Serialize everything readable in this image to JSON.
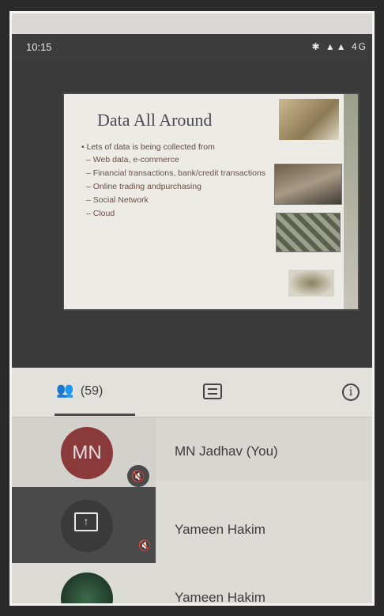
{
  "status_bar": {
    "time": "10:15",
    "network": "4G"
  },
  "slide": {
    "title": "Data All Around",
    "bullet": "Lets of data is being collected from",
    "sub_bullets": [
      "Web data, e-commerce",
      "Financial transactions, bank/credit transactions",
      "Online trading andpurchasing",
      "Social Network",
      "Cloud"
    ]
  },
  "tabs": {
    "people_count": "(59)",
    "people_icon": "people-icon",
    "chat_icon": "chat-icon",
    "info_icon": "info-icon"
  },
  "participants": [
    {
      "initials": "MN",
      "name": "MN Jadhav (You)",
      "muted": true
    },
    {
      "name": "Yameen Hakim",
      "presenting": true,
      "muted": true
    },
    {
      "name": "Yameen Hakim"
    }
  ],
  "colors": {
    "avatar_mn": "#8a3a3a",
    "dark_tile": "#4a4a4a"
  }
}
